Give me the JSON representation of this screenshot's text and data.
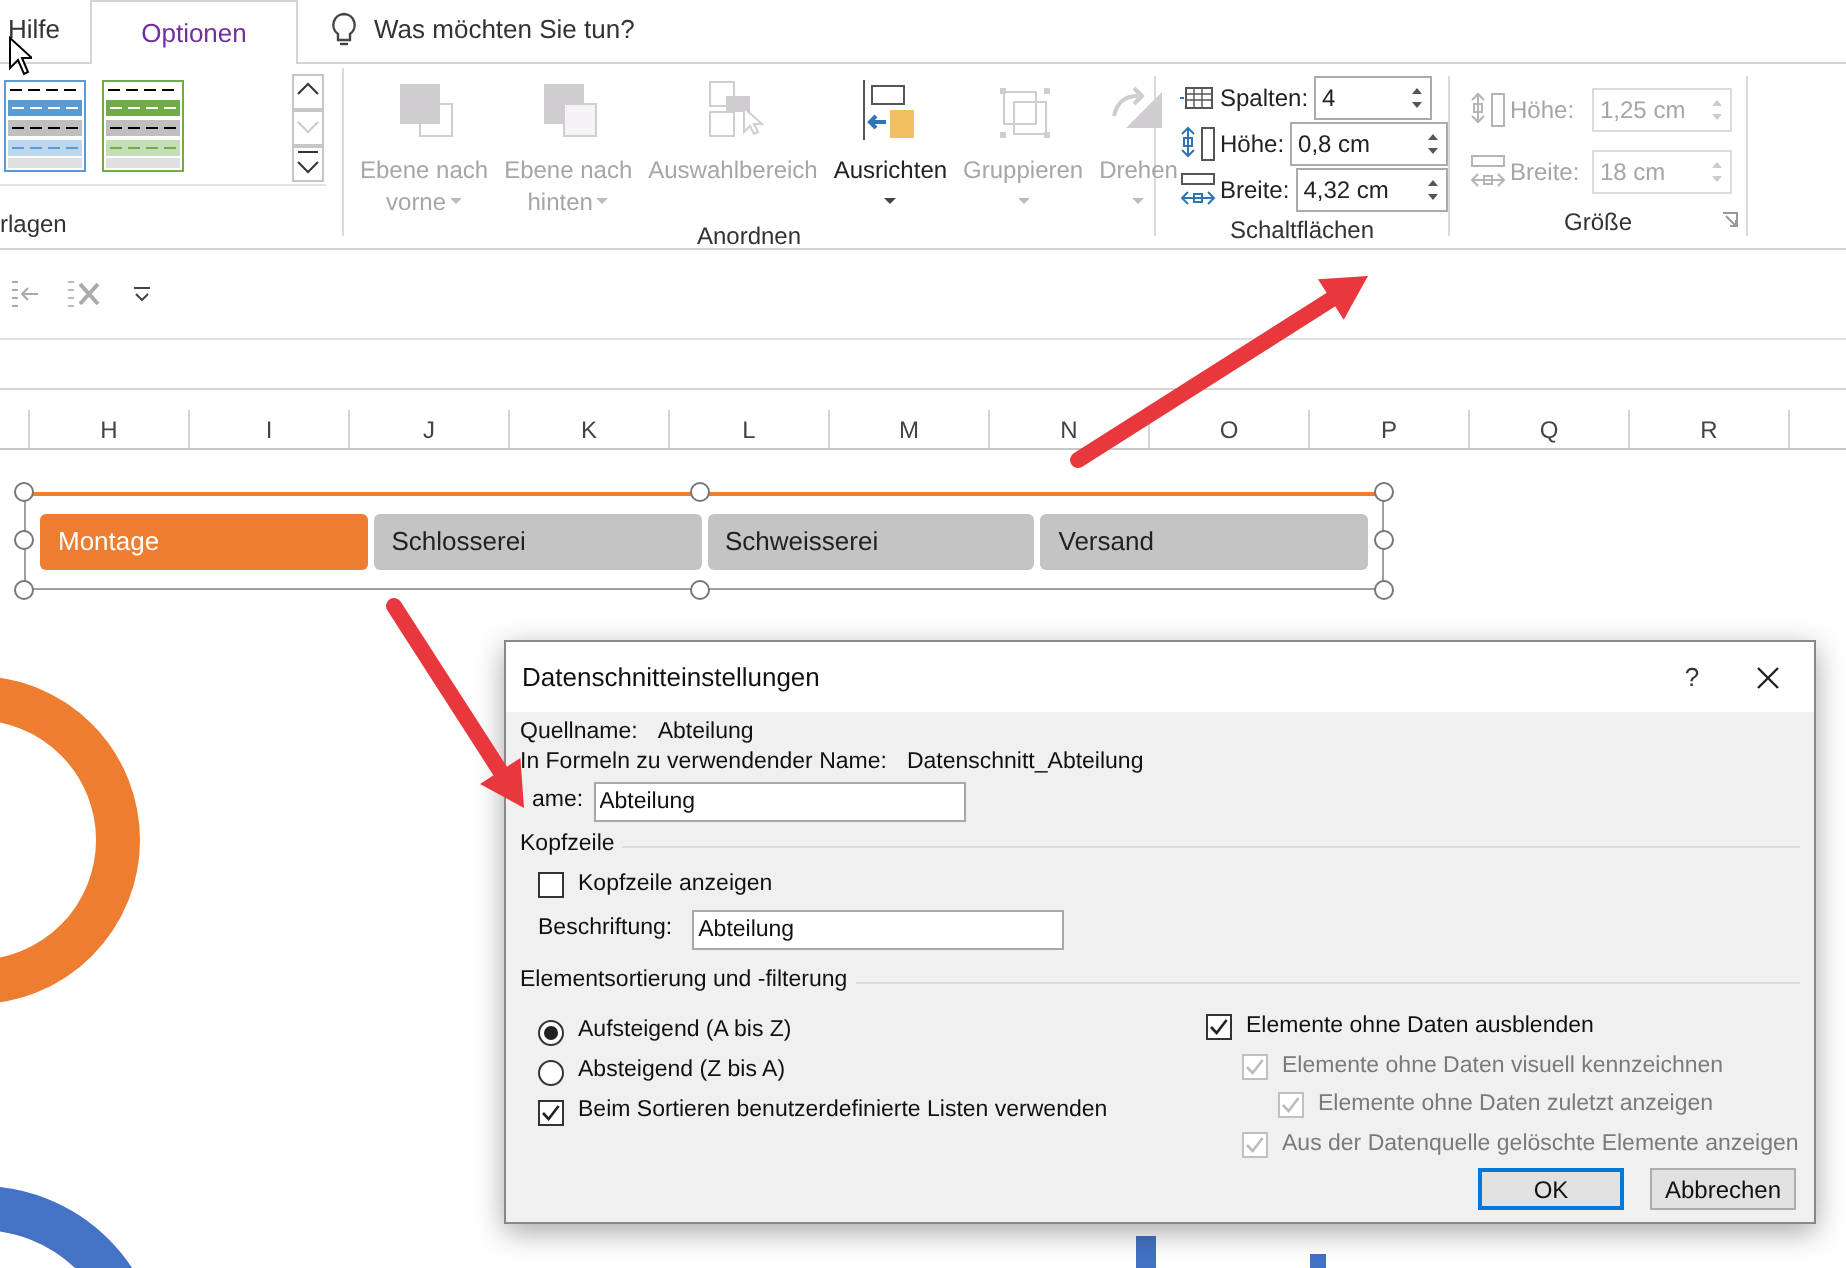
{
  "tabs": [
    {
      "label": "Hilfe",
      "selected": false
    },
    {
      "label": "Optionen",
      "selected": true
    }
  ],
  "tell_me": {
    "placeholder": "Was möchten Sie tun?"
  },
  "ribbon": {
    "gallery": {
      "label": "rlagen",
      "styles": [
        {
          "color": "#5b9bd5"
        },
        {
          "color": "#70ad47"
        }
      ]
    },
    "arrange": {
      "label": "Anordnen",
      "buttons": [
        {
          "kind": "front",
          "lines": [
            "Ebene nach",
            "vorne"
          ],
          "disabled": true,
          "dropdown": true
        },
        {
          "kind": "back",
          "lines": [
            "Ebene nach",
            "hinten"
          ],
          "disabled": true,
          "dropdown": true
        },
        {
          "kind": "pane",
          "lines": [
            "Auswahlbereich"
          ],
          "disabled": true,
          "dropdown": false
        },
        {
          "kind": "align",
          "lines": [
            "Ausrichten"
          ],
          "disabled": false,
          "dropdown": true
        },
        {
          "kind": "group",
          "lines": [
            "Gruppieren"
          ],
          "disabled": true,
          "dropdown": true
        },
        {
          "kind": "rotate",
          "lines": [
            "Drehen"
          ],
          "disabled": true,
          "dropdown": true
        }
      ]
    },
    "buttons": {
      "label": "Schaltflächen",
      "fields": [
        {
          "kind": "columns",
          "label": "Spalten:",
          "value": "4"
        },
        {
          "kind": "height",
          "label": "Höhe:",
          "value": "0,8 cm"
        },
        {
          "kind": "width",
          "label": "Breite:",
          "value": "4,32 cm"
        }
      ]
    },
    "size": {
      "label": "Größe",
      "fields": [
        {
          "kind": "height",
          "label": "Höhe:",
          "value": "1,25 cm",
          "disabled": true
        },
        {
          "kind": "width",
          "label": "Breite:",
          "value": "18 cm",
          "disabled": true
        }
      ]
    }
  },
  "column_headers": [
    "H",
    "I",
    "J",
    "K",
    "L",
    "M",
    "N",
    "O",
    "P",
    "Q",
    "R"
  ],
  "slicer": {
    "items": [
      {
        "label": "Montage",
        "selected": true
      },
      {
        "label": "Schlosserei",
        "selected": false
      },
      {
        "label": "Schweisserei",
        "selected": false
      },
      {
        "label": "Versand",
        "selected": false
      }
    ]
  },
  "dialog": {
    "title": "Datenschnitteinstellungen",
    "help": "?",
    "info": [
      {
        "label": "Quellname:",
        "value": "Abteilung"
      },
      {
        "label": "In Formeln zu verwendender Name:",
        "value": "Datenschnitt_Abteilung"
      }
    ],
    "name_field": {
      "label": "ame:",
      "value": "Abteilung"
    },
    "header_section": {
      "title": "Kopfzeile",
      "show_header": {
        "label": "Kopfzeile anzeigen",
        "checked": false
      },
      "caption": {
        "label": "Beschriftung:",
        "value": "Abteilung"
      }
    },
    "sort_section": {
      "title": "Elementsortierung und -filterung",
      "left": [
        {
          "kind": "radio",
          "label": "Aufsteigend (A bis Z)",
          "selected": true
        },
        {
          "kind": "radio",
          "label": "Absteigend (Z bis A)",
          "selected": false
        },
        {
          "kind": "checkbox",
          "label": "Beim Sortieren benutzerdefinierte Listen verwenden",
          "checked": true
        }
      ],
      "right": [
        {
          "label": "Elemente ohne Daten ausblenden",
          "checked": true,
          "disabled": false,
          "children": [
            {
              "label": "Elemente ohne Daten visuell kennzeichnen",
              "checked": true,
              "disabled": true,
              "children": [
                {
                  "label": "Elemente ohne Daten zuletzt anzeigen",
                  "checked": true,
                  "disabled": true
                }
              ]
            },
            {
              "label": "Aus der Datenquelle gelöschte Elemente anzeigen",
              "checked": true,
              "disabled": true
            }
          ]
        }
      ]
    },
    "buttons": [
      {
        "label": "OK",
        "primary": true
      },
      {
        "label": "Abbrechen",
        "primary": false
      }
    ]
  }
}
